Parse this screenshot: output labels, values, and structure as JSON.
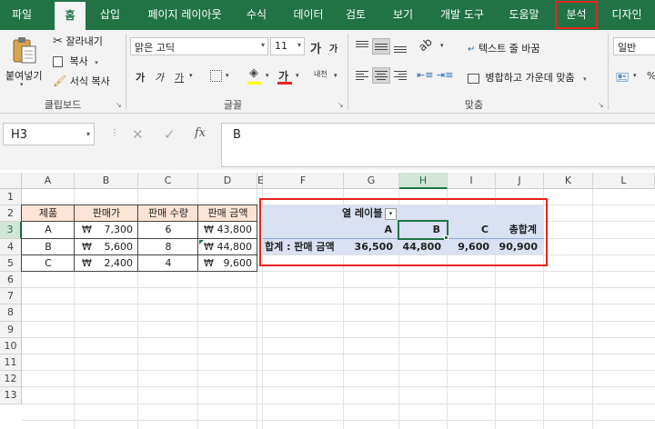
{
  "tabs": [
    "파일",
    "홈",
    "삽입",
    "페이지 레이아웃",
    "수식",
    "데이터",
    "검토",
    "보기",
    "개발 도구",
    "도움말",
    "분석",
    "디자인"
  ],
  "ribbon": {
    "clipboard": {
      "paste": "붙여넣기",
      "cut": "잘라내기",
      "copy": "복사",
      "format_painter": "서식 복사",
      "label": "클립보드"
    },
    "font": {
      "name": "맑은 고딕",
      "size": "11",
      "bold": "가",
      "italic": "가",
      "underline": "가",
      "grow": "가",
      "shrink": "가",
      "font_color": "가",
      "phonetic": "내천",
      "label": "글꼴"
    },
    "alignment": {
      "wrap": "텍스트 줄 바꿈",
      "merge": "병합하고 가운데 맞춤",
      "label": "맞춤"
    },
    "number": {
      "format": "일반",
      "percent": "%"
    }
  },
  "formula_bar": {
    "name_box": "H3",
    "cancel": "✕",
    "enter": "✓",
    "fx": "fx",
    "value": "B"
  },
  "columns": [
    "A",
    "B",
    "C",
    "D",
    "E",
    "F",
    "G",
    "H",
    "I",
    "J",
    "K",
    "L"
  ],
  "rows": [
    "1",
    "2",
    "3",
    "4",
    "5",
    "6",
    "7",
    "8",
    "9",
    "10",
    "11",
    "12",
    "13"
  ],
  "source_table": {
    "headers": [
      "제품",
      "판매가",
      "판매 수량",
      "판매 금액"
    ],
    "rows": [
      {
        "product": "A",
        "price": "7,300",
        "qty": "6",
        "amount": "43,800"
      },
      {
        "product": "B",
        "price": "5,600",
        "qty": "8",
        "amount": "44,800"
      },
      {
        "product": "C",
        "price": "2,400",
        "qty": "4",
        "amount": "9,600"
      }
    ],
    "currency": "₩"
  },
  "pivot": {
    "column_label": "열 레이블",
    "filter_icon": "▾",
    "columns": [
      "A",
      "B",
      "C",
      "총합계"
    ],
    "row_label": "합계 : 판매 금액",
    "values": [
      "36,500",
      "44,800",
      "9,600",
      "90,900"
    ]
  }
}
